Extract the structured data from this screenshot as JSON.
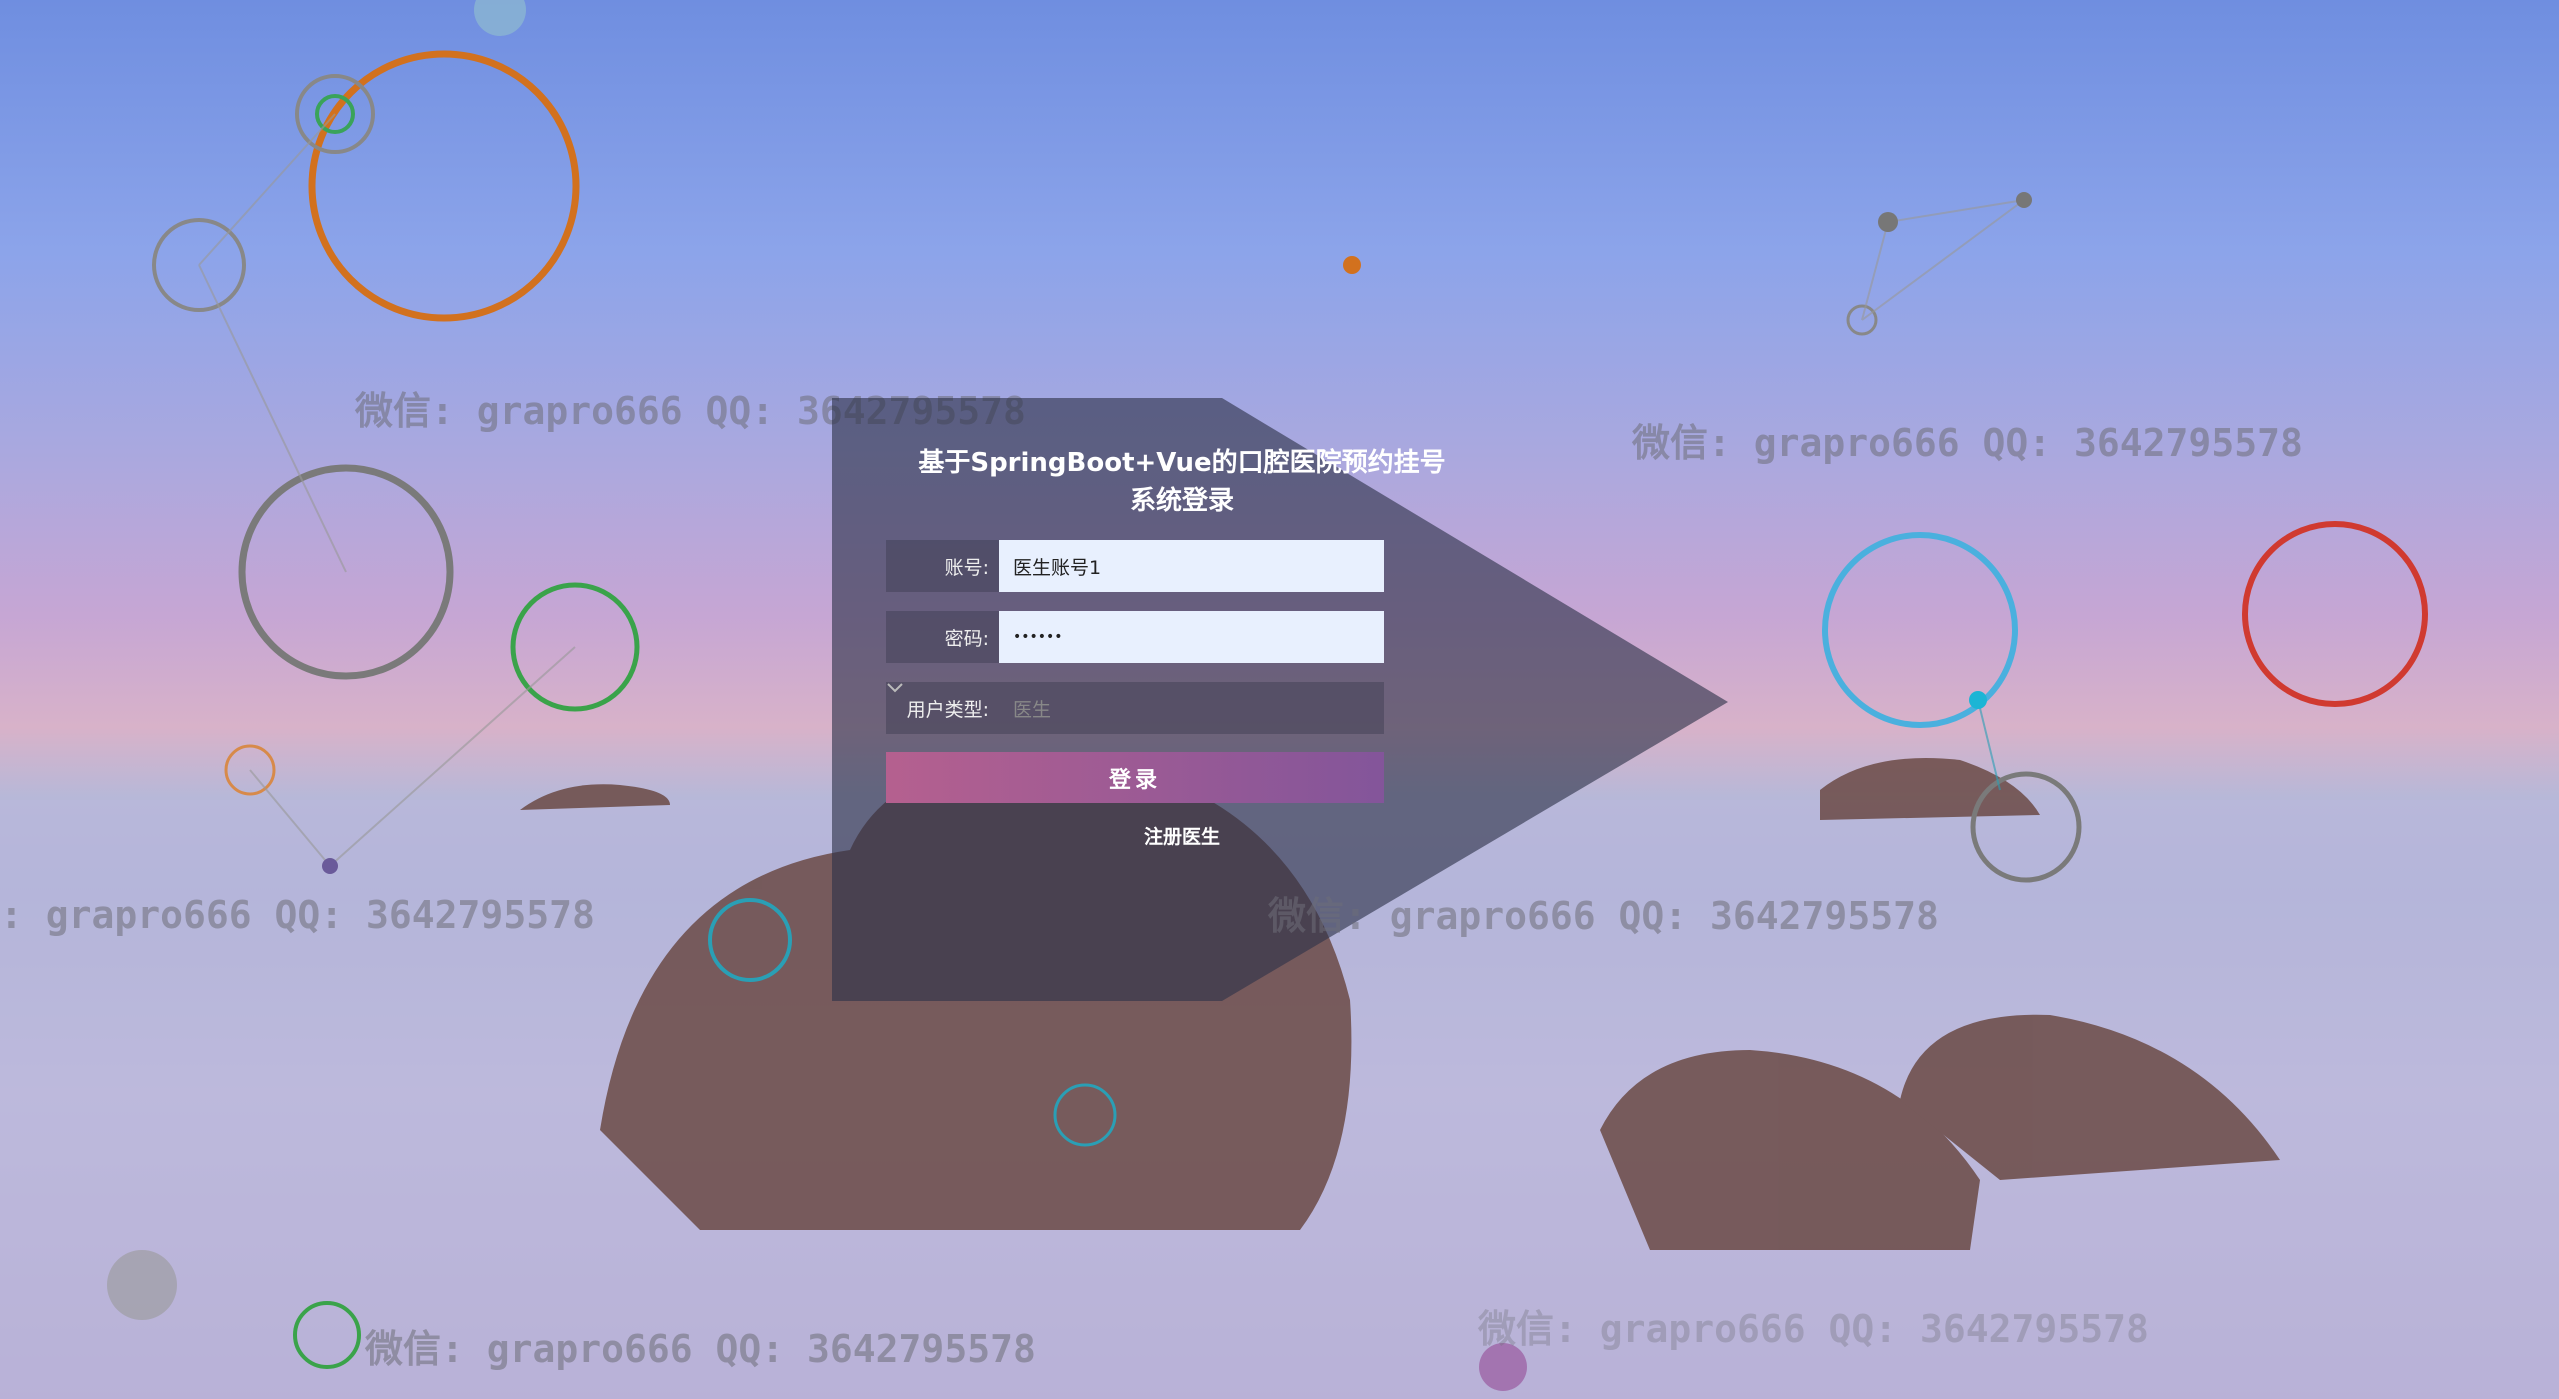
{
  "login": {
    "title_line1": "基于SpringBoot+Vue的口腔医院预约挂号",
    "title_line2": "系统登录",
    "account_label": "账号:",
    "account_value": "医生账号1",
    "password_label": "密码:",
    "password_value": "••••••",
    "usertype_label": "用户类型:",
    "usertype_value": "医生",
    "login_button": "登录",
    "register_link": "注册医生"
  },
  "watermarks": [
    "微信: grapro666 QQ: 3642795578",
    "微信: grapro666 QQ: 3642795578",
    ": grapro666 QQ: 3642795578",
    "微信: grapro666 QQ: 3642795578",
    "微信: grapro666 QQ: 3642795578",
    "微信: grapro666 QQ: 3642795578"
  ],
  "colors": {
    "button_start": "#b5608f",
    "button_end": "#83559a",
    "panel": "rgba(50,55,75,0.6)"
  }
}
